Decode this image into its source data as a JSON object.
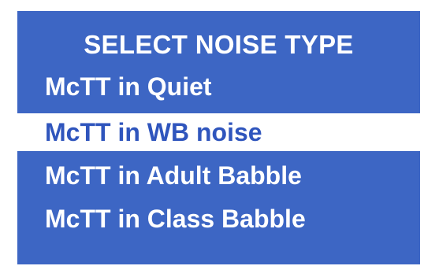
{
  "menu": {
    "title": "SELECT NOISE TYPE",
    "items": [
      {
        "label": "McTT in Quiet",
        "selected": false
      },
      {
        "label": "McTT in WB noise",
        "selected": true
      },
      {
        "label": "McTT in Adult Babble",
        "selected": false
      },
      {
        "label": "McTT in Class Babble",
        "selected": false
      }
    ]
  },
  "colors": {
    "panel_background": "#3d66c4",
    "text": "#ffffff",
    "selected_background": "#ffffff",
    "selected_text": "#2f55bd"
  }
}
